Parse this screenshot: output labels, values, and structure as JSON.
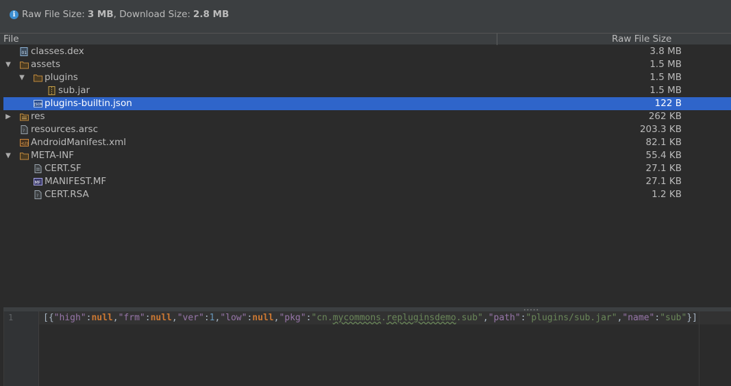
{
  "summary": {
    "raw_label": "Raw File Size:",
    "raw_value": "3 MB",
    "sep": ",",
    "download_label": "Download Size:",
    "download_value": "2.8 MB"
  },
  "columns": {
    "file": "File",
    "raw_size": "Raw File Size"
  },
  "rows": [
    {
      "name": "classes.dex",
      "size": "3.8 MB"
    },
    {
      "name": "assets",
      "size": "1.5 MB"
    },
    {
      "name": "plugins",
      "size": "1.5 MB"
    },
    {
      "name": "sub.jar",
      "size": "1.5 MB"
    },
    {
      "name": "plugins-builtin.json",
      "size": "122 B"
    },
    {
      "name": "res",
      "size": "262 KB"
    },
    {
      "name": "resources.arsc",
      "size": "203.3 KB"
    },
    {
      "name": "AndroidManifest.xml",
      "size": "82.1 KB"
    },
    {
      "name": "META-INF",
      "size": "55.4 KB"
    },
    {
      "name": "CERT.SF",
      "size": "27.1 KB"
    },
    {
      "name": "MANIFEST.MF",
      "size": "27.1 KB"
    },
    {
      "name": "CERT.RSA",
      "size": "1.2 KB"
    }
  ],
  "icons": {
    "info": "info-icon",
    "dex": "dex-file-icon",
    "folder": "folder-icon",
    "jar": "jar-file-icon",
    "json": "json-file-icon",
    "res": "resource-folder-icon",
    "file": "generic-file-icon",
    "xml": "xml-file-icon",
    "mf": "manifest-file-icon"
  },
  "editor": {
    "line_number": "1",
    "tokens": {
      "t0": "[{",
      "t1": "\"high\"",
      "t2": ":",
      "t3": "null",
      "t4": ",",
      "t5": "\"frm\"",
      "t6": ":",
      "t7": "null",
      "t8": ",",
      "t9": "\"ver\"",
      "t10": ":",
      "t11": "1",
      "t12": ",",
      "t13": "\"low\"",
      "t14": ":",
      "t15": "null",
      "t16": ",",
      "t17": "\"pkg\"",
      "t18": ":",
      "t19a": "\"cn.",
      "t19b": "mycommons",
      "t19c": ".",
      "t19d": "repluginsdemo",
      "t19e": ".sub\"",
      "t20": ",",
      "t21": "\"path\"",
      "t22": ":",
      "t23": "\"plugins/sub.jar\"",
      "t24": ",",
      "t25": "\"name\"",
      "t26": ":",
      "t27": "\"sub\"",
      "t28": "}]"
    }
  },
  "colors": {
    "background": "#2b2b2b",
    "selection": "#2f65ca",
    "folder": "#c08a3e",
    "info": "#3d8fd1",
    "json_key": "#9876aa",
    "json_string": "#6a8759",
    "json_keyword": "#cc7832"
  }
}
